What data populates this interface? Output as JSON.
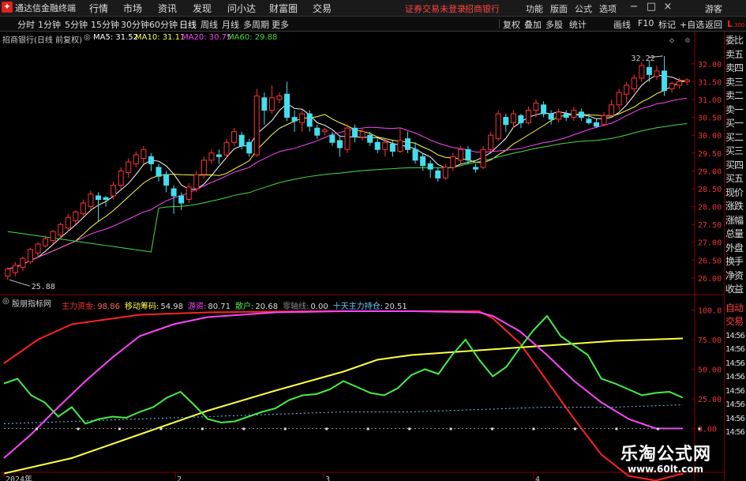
{
  "window": {
    "app_name": "通达信金融终端",
    "menu": [
      "行情",
      "市场",
      "资讯",
      "发现",
      "问小达",
      "财富圈",
      "交易"
    ],
    "red_links": [
      "证券交易未登录",
      "招商银行"
    ],
    "right_tools": [
      "功能",
      "版面",
      "公式",
      "选项"
    ],
    "user": "游客",
    "win_controls": [
      "−",
      "□",
      "×"
    ]
  },
  "toolbar": {
    "periods": [
      "分时",
      "1分钟",
      "5分钟",
      "15分钟",
      "30分钟",
      "60分钟",
      "日线",
      "周线",
      "月线",
      "多周期",
      "更多"
    ],
    "active_period": "日线",
    "right_buttons": [
      "复权",
      "叠加",
      "多股",
      "统计",
      "画线",
      "F10",
      "标记",
      "+自选",
      "返回"
    ]
  },
  "main_chart": {
    "title": "招商银行(日线 前复权)",
    "ma": [
      {
        "label": "MA5: 31.52",
        "color": "#ffffff"
      },
      {
        "label": "MA10: 31.11",
        "color": "#ffff44"
      },
      {
        "label": "MA20: 30.75",
        "color": "#ff44ff"
      },
      {
        "label": "MA60: 29.88",
        "color": "#44dd44"
      }
    ],
    "high_label": "32.22",
    "low_label": "25.88",
    "corner_letter": "L",
    "corner_num": "300"
  },
  "sub_chart": {
    "title": "殷朋指标网",
    "items": [
      {
        "name": "主力资金:",
        "value": "98.86",
        "color": "#ff3333"
      },
      {
        "name": "移动筹码:",
        "value": "54.98",
        "color": "#ffff44"
      },
      {
        "name": "游资:",
        "value": "80.71",
        "color": "#ff44ff"
      },
      {
        "name": "散户:",
        "value": "20.68",
        "color": "#44ee44"
      },
      {
        "name": "零轴线:",
        "value": "0.00",
        "color": "#888888"
      },
      {
        "name": "十天主力持仓:",
        "value": "20.51",
        "color": "#66ccff"
      }
    ]
  },
  "right_panel": {
    "items": [
      "委比",
      "卖五",
      "卖四",
      "卖三",
      "卖二",
      "卖一",
      "买一",
      "买二",
      "买三",
      "买四",
      "买五",
      "现价",
      "涨跌",
      "涨幅",
      "总量",
      "外盘",
      "换手",
      "净资",
      "收益",
      "自动",
      "交易",
      "14:56",
      "14:56",
      "14:56",
      "14:56",
      "14:56",
      "14:56",
      "14:56",
      "14:56"
    ],
    "highlight_index": 19
  },
  "x_labels": [
    "2024年",
    "2",
    "3",
    "4"
  ],
  "watermark": {
    "title": "乐淘公式网",
    "url": "www.60lt.com"
  },
  "chart_data": [
    {
      "type": "candlestick",
      "title": "招商银行(日线 前复权)",
      "y_ticks": [
        32.0,
        31.5,
        31.0,
        30.5,
        30.0,
        29.5,
        29.0,
        28.5,
        28.0,
        27.5,
        27.0,
        26.5,
        26.0
      ],
      "ylim": [
        25.6,
        32.55
      ],
      "candles": [
        [
          26.05,
          26.25,
          25.95,
          26.3
        ],
        [
          26.15,
          26.35,
          26.05,
          26.45
        ],
        [
          26.3,
          26.55,
          26.2,
          26.6
        ],
        [
          26.45,
          26.8,
          26.4,
          26.85
        ],
        [
          26.7,
          26.95,
          26.6,
          27.0
        ],
        [
          26.9,
          27.1,
          26.85,
          27.2
        ],
        [
          27.05,
          27.3,
          26.95,
          27.35
        ],
        [
          27.2,
          27.5,
          27.1,
          27.55
        ],
        [
          27.4,
          27.7,
          27.3,
          27.8
        ],
        [
          27.6,
          27.85,
          27.5,
          27.9
        ],
        [
          27.8,
          28.1,
          27.7,
          28.2
        ],
        [
          28.0,
          28.35,
          27.9,
          28.45
        ],
        [
          28.3,
          28.2,
          27.6,
          28.4
        ],
        [
          28.25,
          28.2,
          28.0,
          28.3
        ],
        [
          28.3,
          28.6,
          28.2,
          28.7
        ],
        [
          28.6,
          29.0,
          28.5,
          29.1
        ],
        [
          28.95,
          29.25,
          28.8,
          29.35
        ],
        [
          29.2,
          29.45,
          29.1,
          29.55
        ],
        [
          29.35,
          29.6,
          29.2,
          29.7
        ],
        [
          29.4,
          29.2,
          29.0,
          29.5
        ],
        [
          29.1,
          28.85,
          28.7,
          29.2
        ],
        [
          28.9,
          28.6,
          28.4,
          29.0
        ],
        [
          28.5,
          28.3,
          27.8,
          28.6
        ],
        [
          28.3,
          28.1,
          27.9,
          28.4
        ],
        [
          28.2,
          28.55,
          28.1,
          28.65
        ],
        [
          28.5,
          28.9,
          28.4,
          29.0
        ],
        [
          28.9,
          29.3,
          28.8,
          29.4
        ],
        [
          29.3,
          29.5,
          29.2,
          29.6
        ],
        [
          29.45,
          29.4,
          29.2,
          29.6
        ],
        [
          29.45,
          29.8,
          29.35,
          29.9
        ],
        [
          29.8,
          30.1,
          29.7,
          30.2
        ],
        [
          30.0,
          29.7,
          29.6,
          30.1
        ],
        [
          29.8,
          29.5,
          29.4,
          29.9
        ],
        [
          29.45,
          31.1,
          29.4,
          31.3
        ],
        [
          31.05,
          30.7,
          30.3,
          31.2
        ],
        [
          30.7,
          31.05,
          30.6,
          31.4
        ],
        [
          31.0,
          31.1,
          30.9,
          31.2
        ],
        [
          31.15,
          30.5,
          30.4,
          31.5
        ],
        [
          30.5,
          30.4,
          30.1,
          30.7
        ],
        [
          30.35,
          30.6,
          30.1,
          30.7
        ],
        [
          30.6,
          30.25,
          30.1,
          30.7
        ],
        [
          30.2,
          30.0,
          29.9,
          30.3
        ],
        [
          30.1,
          30.15,
          30.0,
          30.2
        ],
        [
          30.0,
          29.8,
          29.7,
          30.1
        ],
        [
          29.85,
          29.65,
          29.4,
          30.0
        ],
        [
          29.6,
          30.2,
          29.5,
          30.3
        ],
        [
          30.2,
          29.95,
          29.8,
          30.3
        ],
        [
          29.95,
          30.1,
          29.85,
          30.2
        ],
        [
          30.0,
          29.8,
          29.7,
          30.1
        ],
        [
          29.8,
          29.6,
          29.5,
          29.9
        ],
        [
          29.6,
          29.8,
          29.4,
          29.9
        ],
        [
          29.75,
          29.55,
          29.4,
          29.85
        ],
        [
          29.55,
          29.85,
          29.5,
          30.2
        ],
        [
          29.9,
          29.6,
          29.5,
          30.1
        ],
        [
          29.6,
          29.3,
          29.2,
          29.8
        ],
        [
          29.4,
          29.15,
          29.0,
          29.5
        ],
        [
          29.2,
          29.05,
          28.8,
          29.3
        ],
        [
          29.0,
          28.8,
          28.7,
          29.1
        ],
        [
          28.8,
          29.1,
          28.75,
          29.2
        ],
        [
          29.1,
          29.4,
          29.0,
          29.5
        ],
        [
          29.3,
          29.6,
          29.2,
          29.7
        ],
        [
          29.6,
          29.3,
          29.2,
          29.7
        ],
        [
          29.1,
          29.05,
          28.95,
          29.2
        ],
        [
          29.1,
          29.6,
          29.05,
          29.7
        ],
        [
          29.6,
          30.0,
          29.55,
          30.1
        ],
        [
          29.9,
          30.6,
          29.85,
          30.7
        ],
        [
          30.5,
          30.3,
          30.1,
          30.6
        ],
        [
          30.35,
          30.6,
          30.2,
          30.7
        ],
        [
          30.55,
          30.35,
          30.2,
          30.6
        ],
        [
          30.35,
          30.7,
          30.3,
          30.8
        ],
        [
          30.7,
          30.9,
          30.5,
          31.0
        ],
        [
          30.85,
          30.6,
          30.5,
          30.95
        ],
        [
          30.6,
          30.45,
          30.3,
          30.7
        ],
        [
          30.45,
          30.65,
          30.35,
          30.75
        ],
        [
          30.6,
          30.5,
          30.4,
          30.7
        ],
        [
          30.5,
          30.7,
          30.4,
          30.8
        ],
        [
          30.65,
          30.5,
          30.4,
          30.75
        ],
        [
          30.45,
          30.35,
          30.3,
          30.6
        ],
        [
          30.35,
          30.25,
          30.2,
          30.45
        ],
        [
          30.3,
          30.55,
          30.25,
          30.65
        ],
        [
          30.55,
          30.85,
          30.5,
          31.0
        ],
        [
          30.85,
          31.2,
          30.7,
          31.3
        ],
        [
          31.15,
          31.4,
          30.9,
          31.5
        ],
        [
          31.3,
          31.6,
          31.2,
          31.7
        ],
        [
          31.6,
          31.95,
          31.5,
          32.05
        ],
        [
          31.9,
          31.7,
          31.5,
          32.1
        ],
        [
          31.65,
          31.8,
          31.55,
          31.95
        ],
        [
          31.8,
          31.25,
          31.1,
          32.22
        ],
        [
          31.3,
          31.45,
          31.2,
          31.5
        ],
        [
          31.4,
          31.5,
          31.3,
          31.6
        ],
        [
          31.5,
          31.55,
          31.4,
          31.6
        ]
      ],
      "series": [
        {
          "name": "MA5",
          "color": "#ffffff"
        },
        {
          "name": "MA10",
          "color": "#ffff44"
        },
        {
          "name": "MA20",
          "color": "#ff44ff"
        },
        {
          "name": "MA60",
          "color": "#44dd44"
        }
      ]
    },
    {
      "type": "line",
      "title": "殷朋指标网",
      "y_ticks": [
        100.0,
        75.0,
        50.0,
        25.0,
        0.0
      ],
      "ylim": [
        -33,
        105
      ],
      "series": [
        {
          "name": "主力资金",
          "color": "#ff2222",
          "x": [
            0,
            5,
            10,
            20,
            30,
            45,
            60,
            70,
            72,
            76,
            80,
            84,
            88,
            92,
            96,
            100
          ],
          "values": [
            55,
            75,
            88,
            96,
            98,
            99,
            99,
            99,
            93,
            72,
            40,
            8,
            -22,
            -40,
            -44,
            -38
          ]
        },
        {
          "name": "移动筹码",
          "color": "#ffff44",
          "x": [
            0,
            10,
            20,
            30,
            40,
            50,
            55,
            60,
            70,
            80,
            90,
            100
          ],
          "values": [
            -38,
            -25,
            -5,
            15,
            32,
            48,
            58,
            62,
            66,
            70,
            74,
            76
          ]
        },
        {
          "name": "游资",
          "color": "#ff44ff",
          "x": [
            0,
            4,
            8,
            12,
            16,
            20,
            25,
            30,
            40,
            50,
            60,
            70,
            72,
            76,
            80,
            84,
            88,
            92,
            96,
            100
          ],
          "values": [
            -25,
            -5,
            18,
            40,
            60,
            78,
            88,
            94,
            98,
            99,
            99,
            98,
            95,
            82,
            62,
            40,
            22,
            8,
            0,
            0
          ]
        },
        {
          "name": "散户",
          "color": "#44ee44",
          "x": [
            0,
            2,
            4,
            6,
            8,
            10,
            12,
            14,
            16,
            18,
            20,
            22,
            24,
            26,
            28,
            30,
            32,
            34,
            36,
            38,
            40,
            42,
            44,
            46,
            48,
            50,
            52,
            54,
            56,
            58,
            60,
            62,
            64,
            66,
            68,
            70,
            72,
            74,
            76,
            78,
            80,
            82,
            84,
            86,
            88,
            90,
            92,
            94,
            96,
            98,
            100
          ],
          "values": [
            38,
            42,
            28,
            22,
            10,
            18,
            4,
            8,
            10,
            9,
            14,
            18,
            26,
            31,
            20,
            8,
            5,
            6,
            10,
            14,
            17,
            24,
            28,
            29,
            33,
            40,
            35,
            30,
            28,
            34,
            45,
            50,
            46,
            62,
            75,
            58,
            44,
            52,
            68,
            83,
            95,
            78,
            70,
            62,
            42,
            38,
            33,
            28,
            30,
            31,
            26
          ]
        },
        {
          "name": "零轴线",
          "color": "#888888",
          "x": [
            0,
            100
          ],
          "values": [
            0,
            0
          ]
        },
        {
          "name": "十天主力持仓",
          "color": "#66ccff",
          "x": [
            0,
            10,
            20,
            30,
            40,
            50,
            60,
            70,
            80,
            90,
            100
          ],
          "values": [
            4,
            6,
            8,
            10,
            12,
            14,
            14,
            16,
            18,
            18,
            20
          ]
        }
      ]
    }
  ]
}
